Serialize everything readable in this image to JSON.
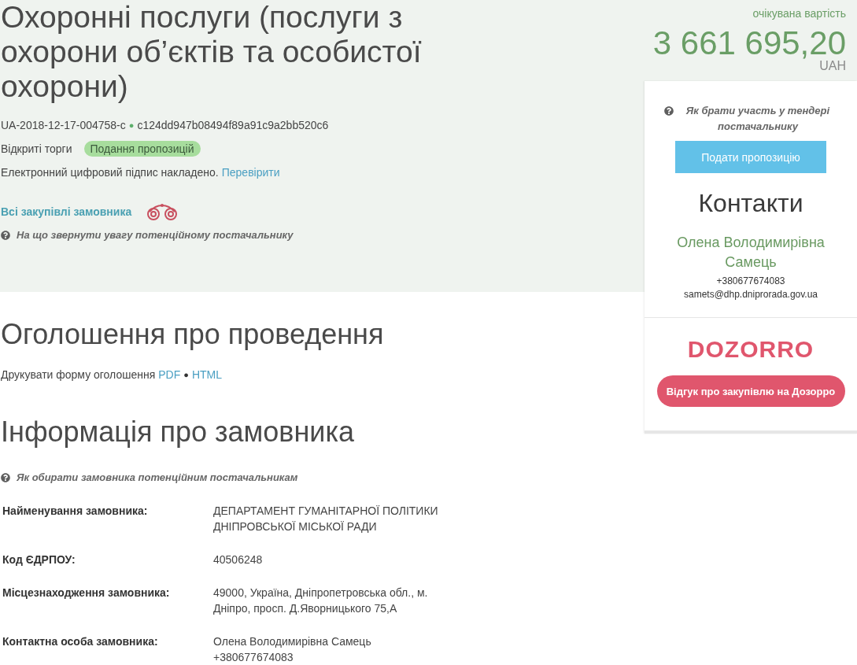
{
  "tender": {
    "title": "Охоронні послуги (послуги з охорони об’єктів та особистої охорони)",
    "id": "UA-2018-12-17-004758-c",
    "id_separator": "●",
    "hash": "c124dd947b08494f89a91c9a2bb520c6",
    "procedure": "Відкриті торги",
    "status_badge": "Подання пропозицій",
    "signature_text": "Електронний цифровий підпис накладено.",
    "signature_link": "Перевірити",
    "buyer_link": "Всі закупівлі замовника",
    "help": "На що звернути увагу потенційному постачальнику"
  },
  "price": {
    "label": "очікувана вартість",
    "amount": "3 661 695,20",
    "currency": "UAH"
  },
  "sidebar": {
    "help": "Як брати участь у тендері постачальнику",
    "submit_button": "Подати пропозицію",
    "contacts": {
      "heading": "Контакти",
      "name": "Олена Володимирівна Самець",
      "phone": "+380677674083",
      "email": "samets@dhp.dniprorada.gov.ua"
    },
    "logo": "DOZORRO",
    "feedback_button": "Відгук про закупівлю на Дозорро"
  },
  "announcement": {
    "heading": "Оголошення про проведення",
    "print_label": "Друкувати форму оголошення",
    "links": [
      "PDF",
      "HTML"
    ],
    "separator": "●"
  },
  "buyer_info": {
    "heading": "Інформація про замовника",
    "help": "Як обирати замовника потенційним постачальникам",
    "rows": [
      {
        "label": "Найменування замовника:",
        "values": [
          "ДЕПАРТАМЕНТ ГУМАНІТАРНОЇ ПОЛІТИКИ ДНІПРОВСЬКОЇ МІСЬКОЇ РАДИ"
        ]
      },
      {
        "label": "Код ЄДРПОУ:",
        "values": [
          "40506248"
        ]
      },
      {
        "label": "Місцезнаходження замовника:",
        "values": [
          "49000, Україна, Дніпропетровська обл., м. Дніпро, просп. Д.Яворницького 75,А"
        ]
      },
      {
        "label": "Контактна особа замовника:",
        "values": [
          "Олена Володимирівна Самець",
          "+380677674083"
        ]
      }
    ]
  }
}
